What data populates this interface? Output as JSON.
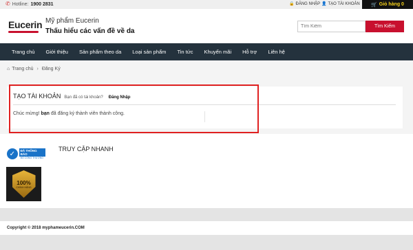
{
  "topbar": {
    "hotline_label": "Hotline:",
    "hotline_number": "1900 2831",
    "login": "ĐĂNG NHẬP",
    "register": "TẠO TÀI KHOẢN",
    "cart": "Giỏ hàng 0"
  },
  "header": {
    "logo_text": "Eucerin",
    "brand_name": "Mỹ phẩm Eucerin",
    "tagline": "Thấu hiểu các vấn đề về da",
    "search_placeholder": "Tìm Kiếm",
    "search_button": "Tìm Kiếm"
  },
  "nav": {
    "items": [
      "Trang chủ",
      "Giới thiệu",
      "Sản phẩm theo da",
      "Loại sản phẩm",
      "Tin tức",
      "Khuyến mãi",
      "Hỗ trợ",
      "Liên hệ"
    ]
  },
  "breadcrumb": {
    "home": "Trang chủ",
    "current": "Đăng Ký"
  },
  "account_panel": {
    "title": "TẠO TÀI KHOẢN",
    "subtitle": "Bạn đã có tài khoản?",
    "login_link": "Đăng Nhập",
    "msg_prefix": "Chúc mừng!",
    "msg_bold": "bạn",
    "msg_suffix": "đã đăng ký thành viên thành công."
  },
  "footer": {
    "bct_line1": "ĐÃ THÔNG BÁO",
    "bct_line2": "BỘ CÔNG THƯƠNG",
    "quick_access_title": "TRUY CẬP NHANH",
    "seal_percent": "100%",
    "seal_label": "CHÍNH HÃNG",
    "copyright": "Copyright © 2018 myphameucerin.COM"
  },
  "colors": {
    "accent_red": "#c8102e",
    "nav_bg": "#24323d",
    "cart_bg": "#111111",
    "cart_text": "#f7d21b",
    "highlight_border": "#e02020"
  }
}
